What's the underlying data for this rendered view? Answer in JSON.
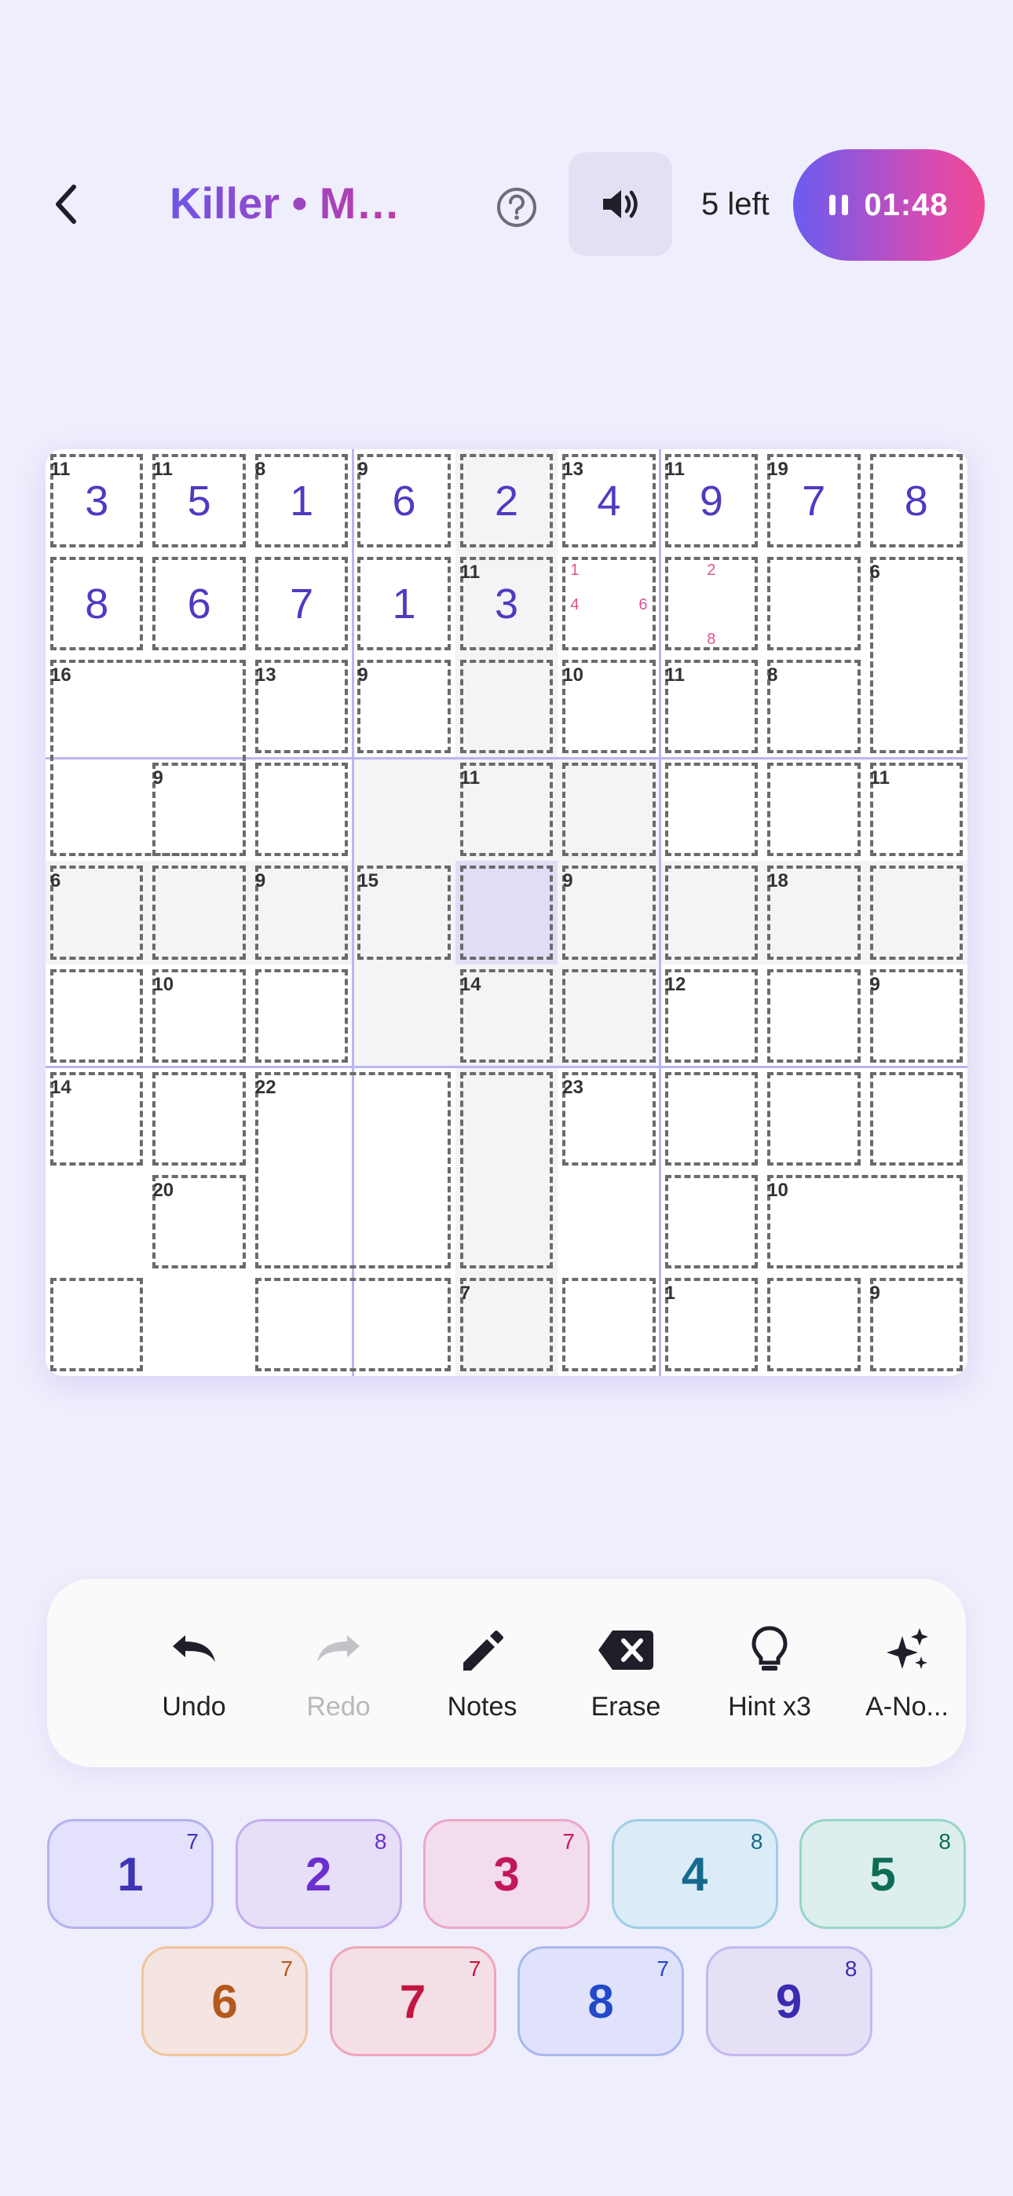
{
  "header": {
    "title": "Killer • M…",
    "remaining": "5 left",
    "timer": "01:48"
  },
  "board": {
    "values": [
      [
        "3",
        "5",
        "1",
        "6",
        "2",
        "4",
        "9",
        "7",
        "8"
      ],
      [
        "8",
        "6",
        "7",
        "1",
        "3",
        "",
        "",
        "",
        ""
      ],
      [
        "",
        "",
        "",
        "",
        "",
        "",
        "",
        "",
        ""
      ],
      [
        "",
        "",
        "",
        "",
        "",
        "",
        "",
        "",
        ""
      ],
      [
        "",
        "",
        "",
        "",
        "",
        "",
        "",
        "",
        ""
      ],
      [
        "",
        "",
        "",
        "",
        "",
        "",
        "",
        "",
        ""
      ],
      [
        "",
        "",
        "",
        "",
        "",
        "",
        "",
        "",
        ""
      ],
      [
        "",
        "",
        "",
        "",
        "",
        "",
        "",
        "",
        ""
      ],
      [
        "",
        "",
        "",
        "",
        "",
        "",
        "",
        "",
        ""
      ]
    ],
    "notes": [
      {
        "row": 1,
        "col": 5,
        "digits": [
          "1",
          "4",
          "6"
        ]
      },
      {
        "row": 1,
        "col": 6,
        "digits": [
          "2",
          "8"
        ]
      }
    ],
    "cages": [
      {
        "sum": "11",
        "cells": [
          [
            0,
            0
          ]
        ]
      },
      {
        "sum": "11",
        "cells": [
          [
            0,
            1
          ]
        ]
      },
      {
        "sum": "8",
        "cells": [
          [
            0,
            2
          ]
        ]
      },
      {
        "sum": "9",
        "cells": [
          [
            0,
            3
          ]
        ]
      },
      {
        "sum": "",
        "cells": [
          [
            0,
            4
          ]
        ]
      },
      {
        "sum": "13",
        "cells": [
          [
            0,
            5
          ]
        ]
      },
      {
        "sum": "11",
        "cells": [
          [
            0,
            6
          ]
        ]
      },
      {
        "sum": "19",
        "cells": [
          [
            0,
            7
          ]
        ]
      },
      {
        "sum": "",
        "cells": [
          [
            0,
            8
          ]
        ]
      },
      {
        "sum": "",
        "cells": [
          [
            1,
            0
          ]
        ]
      },
      {
        "sum": "",
        "cells": [
          [
            1,
            1
          ]
        ]
      },
      {
        "sum": "",
        "cells": [
          [
            1,
            2
          ]
        ]
      },
      {
        "sum": "",
        "cells": [
          [
            1,
            3
          ]
        ]
      },
      {
        "sum": "11",
        "cells": [
          [
            1,
            4
          ]
        ]
      },
      {
        "sum": "",
        "cells": [
          [
            1,
            5
          ]
        ]
      },
      {
        "sum": "",
        "cells": [
          [
            1,
            6
          ]
        ]
      },
      {
        "sum": "",
        "cells": [
          [
            1,
            7
          ]
        ]
      },
      {
        "sum": "6",
        "cells": [
          [
            1,
            8
          ],
          [
            2,
            8
          ]
        ]
      },
      {
        "sum": "16",
        "cells": [
          [
            2,
            0
          ],
          [
            2,
            1
          ],
          [
            3,
            0
          ]
        ]
      },
      {
        "sum": "13",
        "cells": [
          [
            2,
            2
          ]
        ]
      },
      {
        "sum": "9",
        "cells": [
          [
            2,
            3
          ]
        ]
      },
      {
        "sum": "",
        "cells": [
          [
            2,
            4
          ]
        ]
      },
      {
        "sum": "10",
        "cells": [
          [
            2,
            5
          ]
        ]
      },
      {
        "sum": "11",
        "cells": [
          [
            2,
            6
          ]
        ]
      },
      {
        "sum": "8",
        "cells": [
          [
            2,
            7
          ]
        ]
      },
      {
        "sum": "9",
        "cells": [
          [
            3,
            1
          ]
        ]
      },
      {
        "sum": "",
        "cells": [
          [
            3,
            2
          ]
        ]
      },
      {
        "sum": "11",
        "cells": [
          [
            3,
            4
          ]
        ]
      },
      {
        "sum": "",
        "cells": [
          [
            3,
            5
          ]
        ]
      },
      {
        "sum": "",
        "cells": [
          [
            3,
            6
          ]
        ]
      },
      {
        "sum": "",
        "cells": [
          [
            3,
            7
          ]
        ]
      },
      {
        "sum": "11",
        "cells": [
          [
            3,
            8
          ]
        ]
      },
      {
        "sum": "6",
        "cells": [
          [
            4,
            0
          ]
        ]
      },
      {
        "sum": "",
        "cells": [
          [
            4,
            1
          ]
        ]
      },
      {
        "sum": "9",
        "cells": [
          [
            4,
            2
          ]
        ]
      },
      {
        "sum": "15",
        "cells": [
          [
            4,
            3
          ]
        ]
      },
      {
        "sum": "",
        "cells": [
          [
            4,
            4
          ]
        ]
      },
      {
        "sum": "9",
        "cells": [
          [
            4,
            5
          ]
        ]
      },
      {
        "sum": "",
        "cells": [
          [
            4,
            6
          ]
        ]
      },
      {
        "sum": "18",
        "cells": [
          [
            4,
            7
          ]
        ]
      },
      {
        "sum": "",
        "cells": [
          [
            4,
            8
          ]
        ]
      },
      {
        "sum": "",
        "cells": [
          [
            5,
            0
          ]
        ]
      },
      {
        "sum": "10",
        "cells": [
          [
            5,
            1
          ]
        ]
      },
      {
        "sum": "",
        "cells": [
          [
            5,
            2
          ]
        ]
      },
      {
        "sum": "14",
        "cells": [
          [
            5,
            4
          ]
        ]
      },
      {
        "sum": "",
        "cells": [
          [
            5,
            5
          ]
        ]
      },
      {
        "sum": "12",
        "cells": [
          [
            5,
            6
          ]
        ]
      },
      {
        "sum": "",
        "cells": [
          [
            5,
            7
          ]
        ]
      },
      {
        "sum": "9",
        "cells": [
          [
            5,
            8
          ]
        ]
      },
      {
        "sum": "14",
        "cells": [
          [
            6,
            0
          ]
        ]
      },
      {
        "sum": "",
        "cells": [
          [
            6,
            1
          ]
        ]
      },
      {
        "sum": "22",
        "cells": [
          [
            6,
            2
          ],
          [
            6,
            3
          ],
          [
            7,
            2
          ],
          [
            7,
            3
          ]
        ]
      },
      {
        "sum": "",
        "cells": [
          [
            6,
            4
          ],
          [
            7,
            4
          ]
        ]
      },
      {
        "sum": "23",
        "cells": [
          [
            6,
            5
          ]
        ]
      },
      {
        "sum": "",
        "cells": [
          [
            6,
            6
          ]
        ]
      },
      {
        "sum": "",
        "cells": [
          [
            6,
            7
          ]
        ]
      },
      {
        "sum": "",
        "cells": [
          [
            6,
            8
          ]
        ]
      },
      {
        "sum": "20",
        "cells": [
          [
            7,
            1
          ]
        ]
      },
      {
        "sum": "",
        "cells": [
          [
            7,
            6
          ]
        ]
      },
      {
        "sum": "10",
        "cells": [
          [
            7,
            7
          ],
          [
            7,
            8
          ]
        ]
      },
      {
        "sum": "",
        "cells": [
          [
            8,
            0
          ]
        ]
      },
      {
        "sum": "",
        "cells": [
          [
            8,
            2
          ],
          [
            8,
            3
          ]
        ]
      },
      {
        "sum": "7",
        "cells": [
          [
            8,
            4
          ]
        ]
      },
      {
        "sum": "",
        "cells": [
          [
            8,
            5
          ]
        ]
      },
      {
        "sum": "1",
        "cells": [
          [
            8,
            6
          ]
        ]
      },
      {
        "sum": "",
        "cells": [
          [
            8,
            7
          ]
        ]
      },
      {
        "sum": "9",
        "cells": [
          [
            8,
            8
          ]
        ]
      }
    ],
    "selected": [
      4,
      4
    ]
  },
  "toolbar": {
    "undo": "Undo",
    "redo": "Redo",
    "notes": "Notes",
    "erase": "Erase",
    "hint": "Hint x3",
    "auto_notes": "A-No..."
  },
  "numpad": [
    {
      "digit": "1",
      "count": "7",
      "color": "#3f34b5",
      "bg": "#e3e1fb",
      "border": "#b6b1ef"
    },
    {
      "digit": "2",
      "count": "8",
      "color": "#6a2fcf",
      "bg": "#e7def8",
      "border": "#c3adee"
    },
    {
      "digit": "3",
      "count": "7",
      "color": "#c2185b",
      "bg": "#f3dcec",
      "border": "#eca7c9"
    },
    {
      "digit": "4",
      "count": "8",
      "color": "#146a8c",
      "bg": "#dcebf8",
      "border": "#9ccfe6"
    },
    {
      "digit": "5",
      "count": "8",
      "color": "#0d6e55",
      "bg": "#dcefee",
      "border": "#97d6c8"
    },
    {
      "digit": "6",
      "count": "7",
      "color": "#b4581c",
      "bg": "#f4e4e2",
      "border": "#f1c49b"
    },
    {
      "digit": "7",
      "count": "7",
      "color": "#c1173f",
      "bg": "#f5dfe6",
      "border": "#eea5b8"
    },
    {
      "digit": "8",
      "count": "7",
      "color": "#2349c8",
      "bg": "#dfe2fa",
      "border": "#a8b7ee"
    },
    {
      "digit": "9",
      "count": "8",
      "color": "#3a2cb0",
      "bg": "#e6e0f6",
      "border": "#c5b7ee"
    }
  ]
}
